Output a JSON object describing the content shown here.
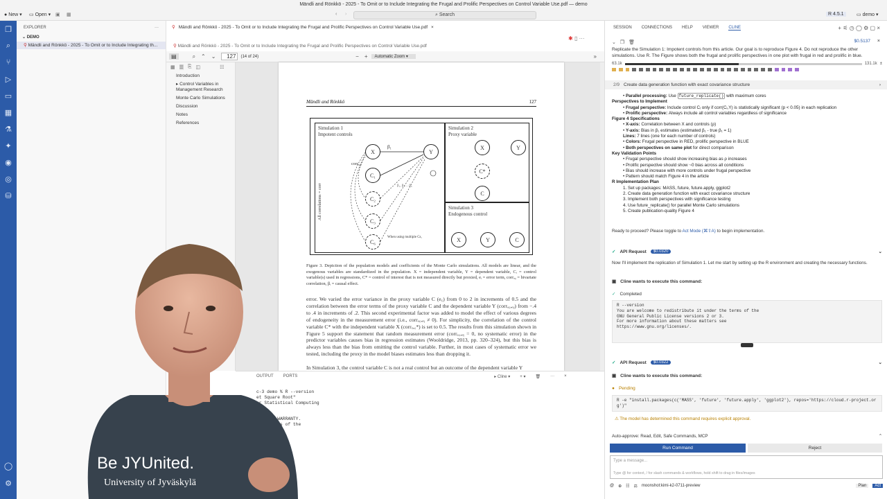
{
  "window": {
    "title": "Mändli and Rönkkö - 2025 - To Omit or to Include Integrating the Frugal and Prolific Perspectives on Control Variable Use.pdf — demo",
    "new_label": "New",
    "open_label": "Open",
    "search_placeholder": "Search",
    "r_version": "R 4.5.1",
    "workspace": "demo"
  },
  "explorer": {
    "header": "EXPLORER",
    "section": "DEMO",
    "file": "Mändli and Rönkkö - 2025 - To Omit or to Include Integrating th..."
  },
  "editor": {
    "tab_label": "Mändli and Rönkkö - 2025 - To Omit or to Include Integrating the Frugal and Prolific Perspectives on Control Variable Use.pdf",
    "breadcrumb": "Mändli and Rönkkö - 2025 - To Omit or to Include Integrating the Frugal and Prolific Perspectives on Control Variable Use.pdf",
    "page_input": "127",
    "page_count": "(14 of 24)",
    "zoom": "Automatic Zoom"
  },
  "outline": [
    "Introduction",
    "Control Variables in Management Research",
    "Monte Carlo Simulations",
    "Discussion",
    "Notes",
    "References"
  ],
  "pdf": {
    "header_left": "Mändli and Rönkkö",
    "header_right": "127",
    "sim1_title": "Simulation 1",
    "sim1_sub": "Impotent controls",
    "sim2_title": "Simulation 2",
    "sim2_sub": "Proxy variable",
    "sim3_title": "Simulation 3",
    "sim3_sub": "Endogenous control",
    "all_corr": "All correlations = corr",
    "multiple_cs": "When using multiple Cs,",
    "caption": "Figure 3.  Depiction of the population models and coefficients of the Monte Carlo simulations. All models are linear, and the exogenous variables are standardized in the population. X = independent variable, Y = dependent variable, Cᵢ = control variable(s) used in regressions, C* = control of interest that is not measured directly but proxied, eᵢ = error term, corrₓᵧ = bivariate correlation, βᵢ = causal effect.",
    "body": "error. We varied the error variance in the proxy variable C (e꜀) from 0 to 2 in increments of 0.5 and the correlation between the error terms of the proxy variable C and the dependent variable Y (corrₑ꜀,ₑᵧ) from −.4 to .4 in increments of .2. This second experimental factor was added to model the effect of various degrees of endogeneity in the measurement error (i.e., corrₑ꜀,ₑᵧ ≠ 0). For simplicity, the correlation of the control variable C* with the independent variable X (corrₓ,꜀*) is set to 0.5. The results from this simulation shown in Figure 5 support the statement that random measurement error (corrₑ꜀,ₑᵧ = 0, no systematic error) in the predictor variables causes bias in regression estimates (Wooldridge, 2013, pp. 320–324), but this bias is always less than the bias from omitting the control variable. Further, in most cases of systematic error we tested, including the proxy in the model biases estimates less than dropping it.",
    "body_tail": "In Simulation 3, the control variable C is not a real control but an outcome of the dependent variable Y"
  },
  "panel": {
    "output_tab": "OUTPUT",
    "ports_tab": "PORTS",
    "cline_label": "Cline",
    "terminal": "c-3 demo % R --version\net Square Root\"\nor Statistical Computing\n\n\nTELY NO WARRANTY.\n the terms of the\n\nsee\n\no % ▯"
  },
  "right": {
    "tabs": [
      "SESSION",
      "CONNECTIONS",
      "HELP",
      "VIEWER",
      "CLINE"
    ],
    "cost_total": "$0.5137",
    "task": "Replicate the Simulation 1: Impotent controls from this article. Our goal is to reproduce Figure 4. Do not reproduce the other simulations. Use R.  The Figure shows both the frugal and prolific perspectives in one plot with frugal in red and prolific in blue.",
    "ctx_used": "63.1k",
    "ctx_max": "131.1k",
    "ctx_fraction": 0.48,
    "step_num": "2/9",
    "step_title": "Create data generation function with exact covariance structure",
    "plan": [
      {
        "type": "li",
        "bold": "Parallel processing:",
        "text": "Use",
        "code": "future_replicate()",
        "rest": "with maximum cores"
      },
      {
        "type": "h",
        "text": "Perspectives to Implement"
      },
      {
        "type": "li",
        "bold": "Frugal perspective:",
        "text": "Include control Cᵢ only if corr(Cᵢ,Y) is statistically significant (p < 0.05) in each replication"
      },
      {
        "type": "li",
        "bold": "Prolific perspective:",
        "text": "Always include all control variables regardless of significance"
      },
      {
        "type": "h",
        "text": "Figure 4 Specifications"
      },
      {
        "type": "li",
        "bold": "X-axis:",
        "text": "Correlation between X and controls (ρ)"
      },
      {
        "type": "li",
        "bold": "Y-axis:",
        "text": "Bias in β₁ estimates (estimated β₁ - true β₁ = 1)"
      },
      {
        "type": "li",
        "bold": "Lines:",
        "text": "7 lines (one for each number of controls)"
      },
      {
        "type": "li",
        "bold": "Colors:",
        "text": "Frugal perspective in RED, prolific perspective in BLUE"
      },
      {
        "type": "li",
        "bold": "Both perspectives on same plot",
        "text": "for direct comparison"
      },
      {
        "type": "h",
        "text": "Key Validation Points"
      },
      {
        "type": "li",
        "bold": "",
        "text": "Frugal perspective should show increasing bias as ρ increases"
      },
      {
        "type": "li",
        "bold": "",
        "text": "Prolific perspective should show ~0 bias across all conditions"
      },
      {
        "type": "li",
        "bold": "",
        "text": "Bias should increase with more controls under frugal perspective"
      },
      {
        "type": "li",
        "bold": "",
        "text": "Pattern should match Figure 4 in the article"
      },
      {
        "type": "h",
        "text": "R Implementation Plan"
      },
      {
        "type": "li",
        "bold": "",
        "text": "1. Set up packages: MASS, future, future.apply, ggplot2"
      },
      {
        "type": "li",
        "bold": "",
        "text": "2. Create data generation function with exact covariance structure"
      },
      {
        "type": "li",
        "bold": "",
        "text": "3. Implement both perspectives with significance testing"
      },
      {
        "type": "li",
        "bold": "",
        "text": "4. Use future_replicate() for parallel Monte Carlo simulations"
      },
      {
        "type": "li",
        "bold": "",
        "text": "5. Create publication-quality Figure 4"
      }
    ],
    "ready": "Ready to proceed? Please toggle to",
    "act_mode": "Act Mode (⌘⇧A)",
    "ready_tail": "to begin implementation.",
    "api1_label": "API Request",
    "api1_cost": "$0.0320",
    "api1_text": "Now I'll implement the replication of Simulation 1. Let me start by setting up the R environment and creating the necessary functions.",
    "exec_label": "Cline wants to execute this command:",
    "completed": "Completed",
    "cmd1": "R --version\nYou are welcome to redistribute it under the terms of the\nGNU General Public License versions 2 or 3.\nFor more information about these matters see\nhttps://www.gnu.org/licenses/.",
    "api2_label": "API Request",
    "api2_cost": "$0.0322",
    "exec2_label": "Cline wants to execute this command:",
    "pending": "Pending",
    "cmd2": "R -e \"install.packages(c('MASS', 'future', 'future.apply', 'ggplot2'), repos='https://cloud.r-project.or\ng')\"",
    "warning": "The model has determined this command requires explicit approval.",
    "auto_approve": "Auto-approve: Read, Edit, Safe Commands, MCP",
    "run_label": "Run Command",
    "reject_label": "Reject",
    "msg_placeholder": "Type a message...",
    "msg_hint": "Type @ for context, / for slash commands & workflows, hold shift to drag in files/images",
    "model": "moonshot:kimi-k2-0711-preview",
    "plan_label": "Plan",
    "act_label": "Act"
  },
  "person": {
    "shirt_line1": "Be JYUnited.",
    "shirt_line2": "University of Jyväskylä"
  },
  "colors": {
    "accent": "#2c5ba8",
    "warning": "#b98000"
  }
}
